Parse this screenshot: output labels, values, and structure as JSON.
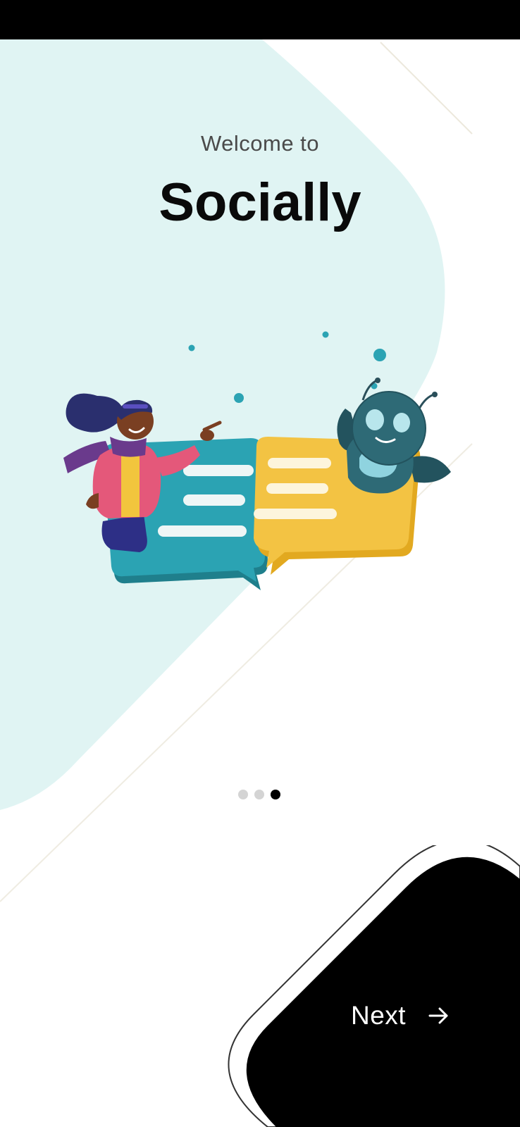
{
  "onboarding": {
    "welcome_text": "Welcome to",
    "app_name": "Socially",
    "pager": {
      "total": 3,
      "active_index": 2
    },
    "next_label": "Next"
  },
  "icons": {
    "next": "arrow-right-icon"
  },
  "colors": {
    "background": "#ffffff",
    "blob": "#e0f4f3",
    "accent_teal": "#2ba3b3",
    "bubble_yellow": "#f3c343",
    "next_button": "#000000",
    "dot_inactive": "#d4d4d4",
    "dot_active": "#000000"
  }
}
